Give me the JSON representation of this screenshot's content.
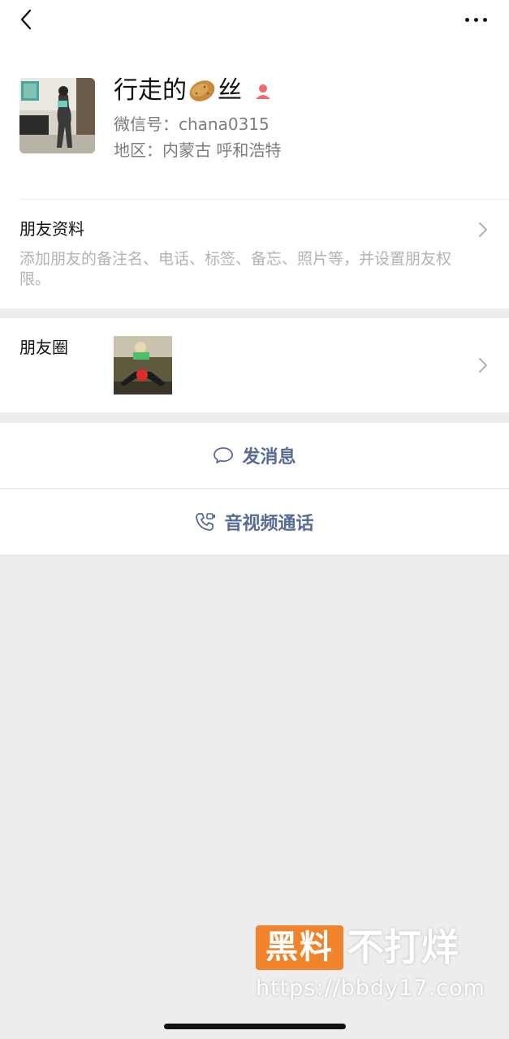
{
  "profile": {
    "name_part1": "行走的",
    "name_part2": "丝",
    "name_emoji": "potato-emoji",
    "wechat_id": "微信号：chana0315",
    "region": "地区：内蒙古 呼和浩特",
    "gender_icon": "female-icon",
    "gender_color": "#f06a6a"
  },
  "friend_profile": {
    "title": "朋友资料",
    "description": "添加朋友的备注名、电话、标签、备忘、照片等，并设置朋友权限。"
  },
  "moments": {
    "title": "朋友圈"
  },
  "actions": {
    "message_label": "发消息",
    "call_label": "音视频通话",
    "accent": "#576b95"
  },
  "watermark": {
    "logo": "黑料",
    "text": "不打烊",
    "url": "https://bbdy17.com"
  },
  "icons": {
    "back": "back-chevron-icon",
    "more": "more-dots-icon",
    "chevron": "chevron-right-icon",
    "message": "chat-bubble-icon",
    "call": "video-call-icon"
  }
}
